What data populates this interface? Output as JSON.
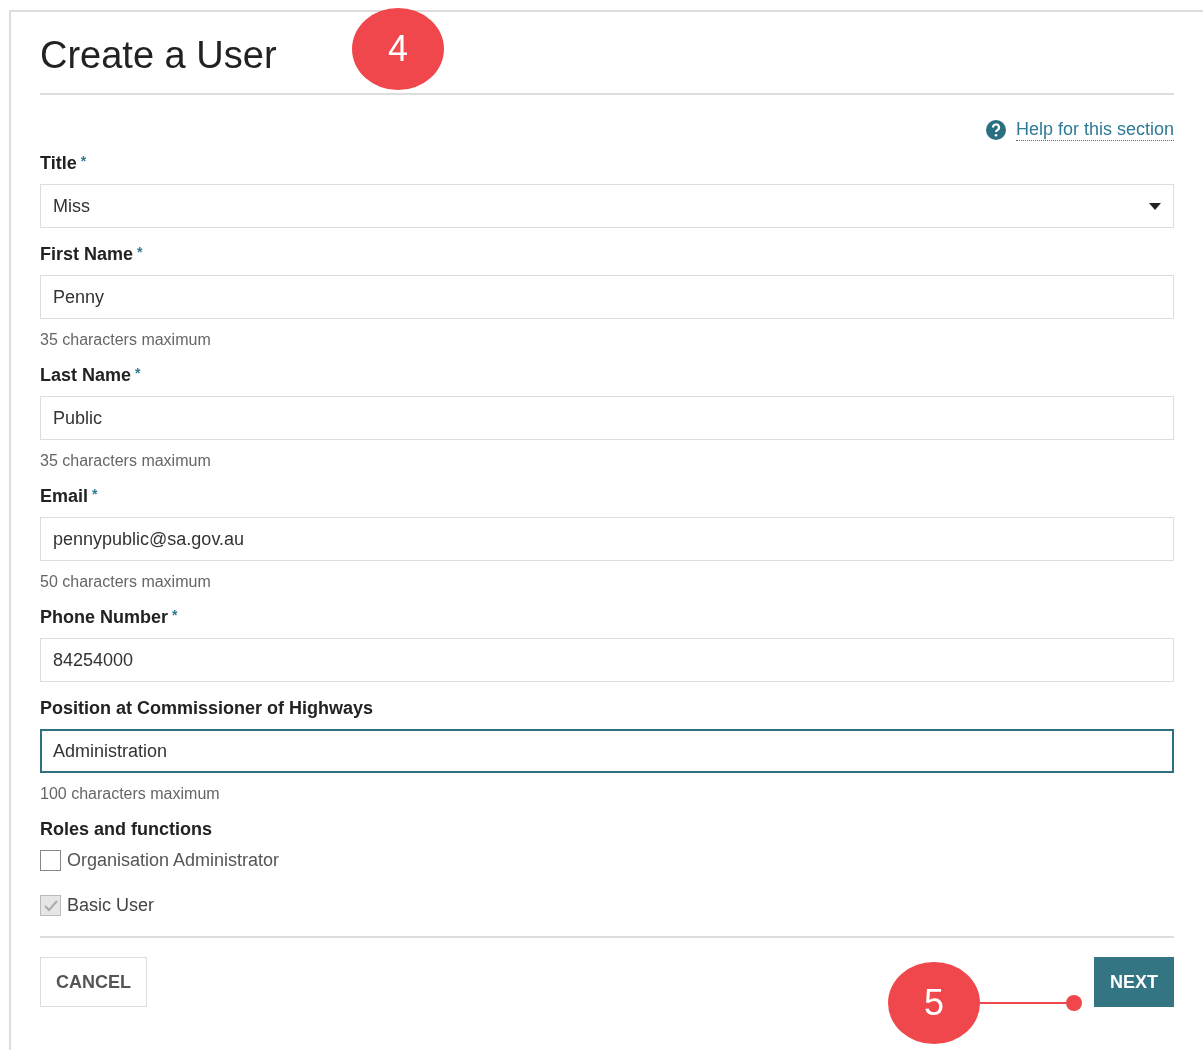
{
  "page": {
    "title": "Create a User",
    "help_link": "Help for this section"
  },
  "fields": [
    {
      "kind": "select",
      "label": "Title",
      "marker": "*",
      "value": "Miss",
      "focused": false
    },
    {
      "kind": "text",
      "label": "First Name",
      "marker": "*",
      "value": "Penny",
      "hint": "35 characters maximum",
      "focused": false
    },
    {
      "kind": "text",
      "label": "Last Name",
      "marker": "*",
      "value": "Public",
      "hint": "35 characters maximum",
      "focused": false
    },
    {
      "kind": "text",
      "label": "Email",
      "marker": "*",
      "value": "pennypublic@sa.gov.au",
      "hint": "50 characters maximum",
      "focused": false
    },
    {
      "kind": "text",
      "label": "Phone Number",
      "marker": "*",
      "value": "84254000",
      "focused": false
    },
    {
      "kind": "text",
      "label": "Position at Commissioner of Highways",
      "value": "Administration",
      "hint": "100 characters maximum",
      "focused": true
    }
  ],
  "roles": {
    "heading": "Roles and functions",
    "options": [
      {
        "label": "Organisation Administrator",
        "checked": false,
        "disabled": false
      },
      {
        "label": "Basic User",
        "checked": true,
        "disabled": true
      }
    ]
  },
  "buttons": [
    {
      "kind": "secondary",
      "label": "CANCEL"
    },
    {
      "kind": "primary",
      "label": "NEXT"
    }
  ],
  "callouts": [
    {
      "label": "4"
    },
    {
      "label": "5",
      "leader": true
    }
  ]
}
